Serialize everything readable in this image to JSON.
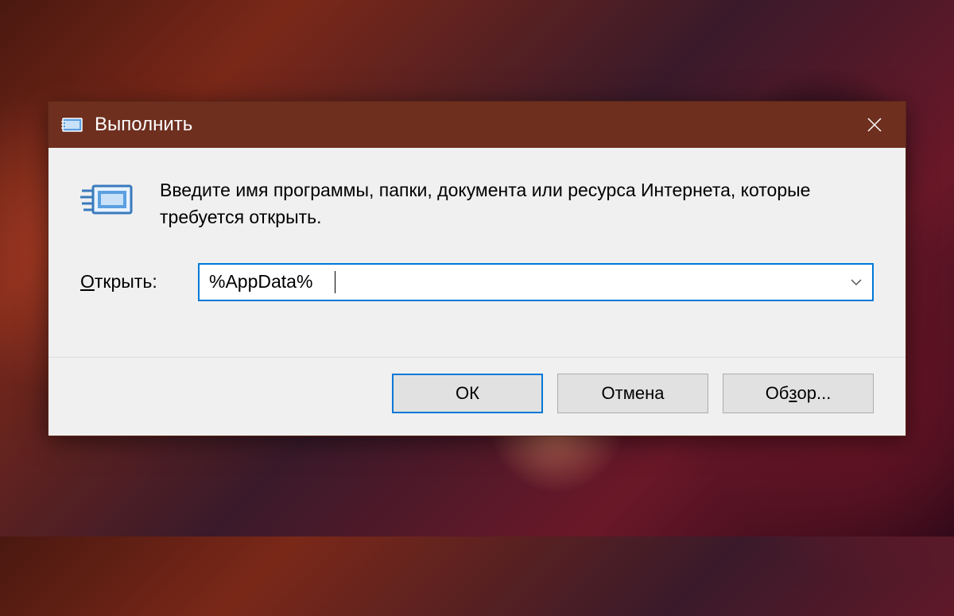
{
  "dialog": {
    "title": "Выполнить",
    "instruction": "Введите имя программы, папки, документа или ресурса Интернета, которые требуется открыть.",
    "input_label_pre": "",
    "input_label_u": "О",
    "input_label_post": "ткрыть:",
    "input_value": "%AppData%",
    "buttons": {
      "ok": "ОК",
      "cancel": "Отмена",
      "browse_pre": "Об",
      "browse_u": "з",
      "browse_post": "ор..."
    }
  }
}
